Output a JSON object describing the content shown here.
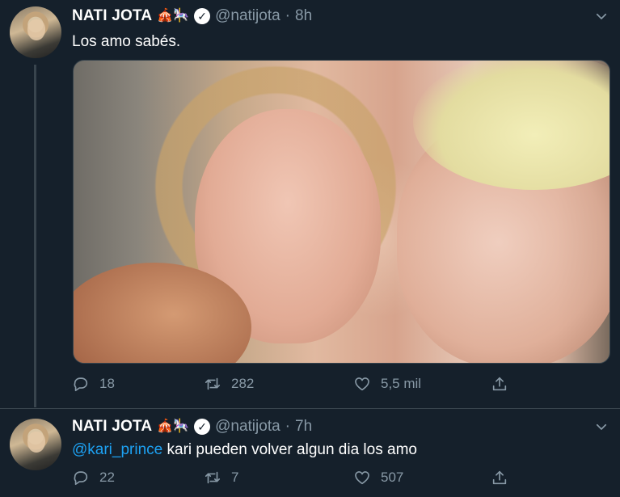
{
  "tweets": [
    {
      "author_name": "NATI JOTA",
      "emojis": "🎪🎠",
      "handle": "@natijota",
      "separator": "·",
      "time": "8h",
      "text": "Los amo sabés.",
      "replies": "18",
      "retweets": "282",
      "likes": "5,5 mil"
    },
    {
      "author_name": "NATI JOTA",
      "emojis": "🎪🎠",
      "handle": "@natijota",
      "separator": "·",
      "time": "7h",
      "mention": "@kari_prince",
      "text": " kari pueden volver algun dia los amo",
      "replies": "22",
      "retweets": "7",
      "likes": "507"
    }
  ],
  "icons": {
    "verified": "verified-badge-icon",
    "more": "chevron-down-icon",
    "reply": "reply-icon",
    "retweet": "retweet-icon",
    "like": "heart-icon",
    "share": "share-icon"
  },
  "colors": {
    "background": "#15202b",
    "secondary_text": "#8899a6",
    "link": "#1da1f2",
    "divider": "#38444d"
  }
}
